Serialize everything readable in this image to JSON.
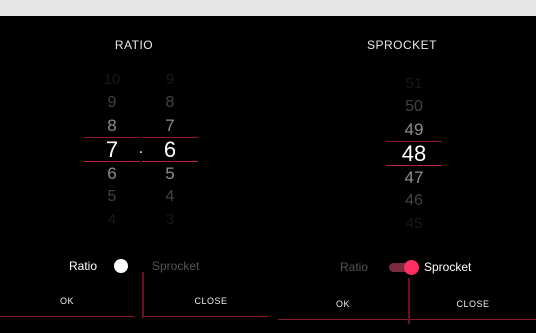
{
  "colors": {
    "accent": "#ff2f66",
    "divider": "#c02040",
    "background": "#000000"
  },
  "left": {
    "title": "RATIO",
    "col1": [
      "10",
      "9",
      "8",
      "7",
      "6",
      "5",
      "4"
    ],
    "col2": [
      "9",
      "8",
      "7",
      "6",
      "5",
      "4",
      "3"
    ],
    "separator": ".",
    "mode_ratio": "Ratio",
    "mode_sprocket": "Sprocket",
    "ok": "OK",
    "close": "CLOSE"
  },
  "right": {
    "title": "SPROCKET",
    "col": [
      "51",
      "50",
      "49",
      "48",
      "47",
      "46",
      "45"
    ],
    "mode_ratio": "Ratio",
    "mode_sprocket": "Sprocket",
    "ok": "OK",
    "close": "CLOSE"
  }
}
